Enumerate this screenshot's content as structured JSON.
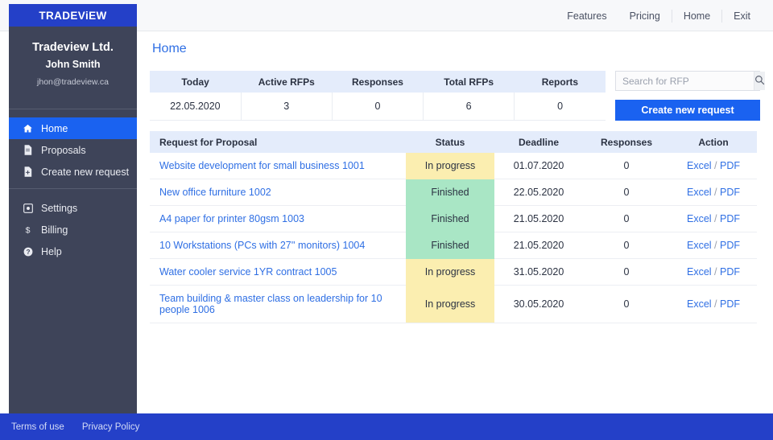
{
  "brand": {
    "logo_text": "TRADEViEW",
    "accent_blue": "#2440c8",
    "link_blue": "#2f6fe4",
    "button_blue": "#1a62f0",
    "sidebar_dark": "#3e4459",
    "status_inprogress_bg": "#fbeeb0",
    "status_finished_bg": "#a9e6c5",
    "table_header_bg": "#e4ecfb"
  },
  "topnav": {
    "items": [
      {
        "label": "Features",
        "divider": false
      },
      {
        "label": "Pricing",
        "divider": false
      },
      {
        "label": "Home",
        "divider": true
      },
      {
        "label": "Exit",
        "divider": true
      }
    ]
  },
  "sidebar": {
    "user": {
      "company": "Tradeview Ltd.",
      "name": "John Smith",
      "email": "jhon@tradeview.ca"
    },
    "primary_items": [
      {
        "label": "Home",
        "icon": "home-icon",
        "active": true
      },
      {
        "label": "Proposals",
        "icon": "file-icon",
        "active": false
      },
      {
        "label": "Create new request",
        "icon": "file-plus-icon",
        "active": false
      }
    ],
    "secondary_items": [
      {
        "label": "Settings",
        "icon": "gear-icon",
        "active": false
      },
      {
        "label": "Billing",
        "icon": "dollar-icon",
        "active": false
      },
      {
        "label": "Help",
        "icon": "question-circle-icon",
        "active": false
      }
    ]
  },
  "main": {
    "page_title": "Home",
    "stats": {
      "headers": [
        "Today",
        "Active RFPs",
        "Responses",
        "Total RFPs",
        "Reports"
      ],
      "values": [
        "22.05.2020",
        "3",
        "0",
        "6",
        "0"
      ]
    },
    "search": {
      "placeholder": "Search for RFP",
      "value": "",
      "icon": "search-icon"
    },
    "create_button": {
      "label": "Create new request"
    },
    "rfp_table": {
      "headers": [
        "Request for Proposal",
        "Status",
        "Deadline",
        "Responses",
        "Action"
      ],
      "action_labels": {
        "excel": "Excel",
        "separator": "/",
        "pdf": "PDF"
      },
      "rows": [
        {
          "name": "Website development for small business 1001",
          "status": "In progress",
          "status_key": "inprogress",
          "deadline": "01.07.2020",
          "responses": "0"
        },
        {
          "name": "New office furniture 1002",
          "status": "Finished",
          "status_key": "finished",
          "deadline": "22.05.2020",
          "responses": "0"
        },
        {
          "name": "A4 paper for printer 80gsm 1003",
          "status": "Finished",
          "status_key": "finished",
          "deadline": "21.05.2020",
          "responses": "0"
        },
        {
          "name": "10 Workstations (PCs with 27'' monitors) 1004",
          "status": "Finished",
          "status_key": "finished",
          "deadline": "21.05.2020",
          "responses": "0"
        },
        {
          "name": "Water cooler service 1YR contract 1005",
          "status": "In progress",
          "status_key": "inprogress",
          "deadline": "31.05.2020",
          "responses": "0"
        },
        {
          "name": "Team building & master class on leadership for 10 people 1006",
          "status": "In progress",
          "status_key": "inprogress",
          "deadline": "30.05.2020",
          "responses": "0"
        }
      ]
    }
  },
  "footer": {
    "links": [
      "Terms of use",
      "Privacy Policy"
    ]
  }
}
